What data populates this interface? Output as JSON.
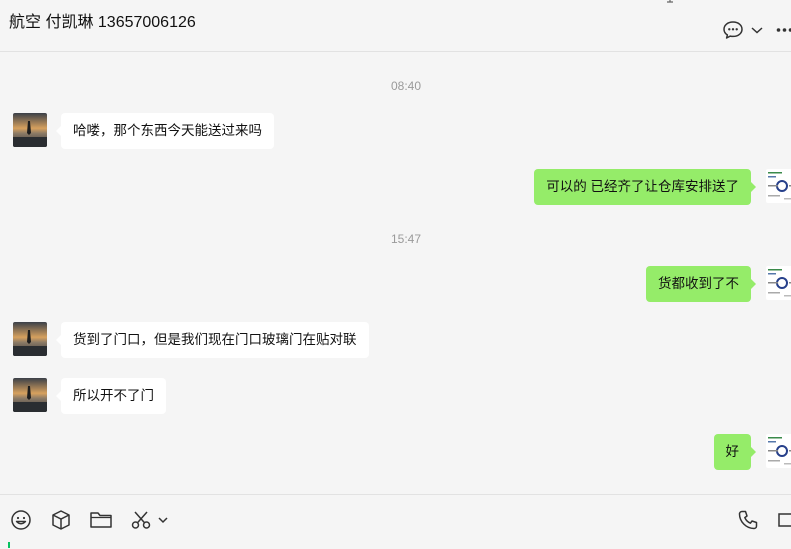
{
  "header": {
    "title": "航空 付凯琳 13657006126"
  },
  "messages": [
    {
      "kind": "time",
      "text": "08:40"
    },
    {
      "kind": "in",
      "text": "哈喽，那个东西今天能送过来吗"
    },
    {
      "kind": "out",
      "text": "可以的 已经齐了让仓库安排送了"
    },
    {
      "kind": "time",
      "text": "15:47"
    },
    {
      "kind": "out",
      "text": "货都收到了不"
    },
    {
      "kind": "in",
      "text": "货到了门口，但是我们现在门口玻璃门在贴对联"
    },
    {
      "kind": "in",
      "text": "所以开不了门"
    },
    {
      "kind": "out",
      "text": "好"
    }
  ],
  "icons": {
    "header": [
      "chat-bubble-icon",
      "chevron-down-icon",
      "more-icon"
    ],
    "toolbar": [
      "emoji-icon",
      "package-icon",
      "folder-icon",
      "scissors-icon",
      "chevron-down-icon",
      "phone-icon",
      "video-icon"
    ]
  },
  "colors": {
    "outgoing_bubble": "#95ec69",
    "incoming_bubble": "#ffffff",
    "background": "#f5f5f5",
    "input_cursor": "#07c160"
  }
}
